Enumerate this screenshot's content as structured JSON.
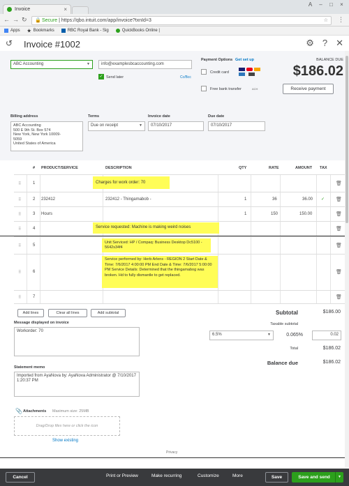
{
  "browser": {
    "tab_title": "Invoice",
    "secure_label": "Secure",
    "url": "https://qbo.intuit.com/app/invoice?txnId=3",
    "bookmarks": [
      "Apps",
      "Bookmarks",
      "RBC Royal Bank - Sig",
      "QuickBooks Online |"
    ]
  },
  "header": {
    "title": "Invoice #1002"
  },
  "customer": {
    "name": "ABC Accounting",
    "email": "info@examplesbcaccounting.com",
    "send_later": "Send later",
    "ccbcc": "Cc/Bcc"
  },
  "payment": {
    "label": "Payment Options",
    "setup_link": "Get set up",
    "credit_card": "Credit card",
    "bank_transfer": "Free bank transfer"
  },
  "balance": {
    "label": "BALANCE DUE",
    "amount": "$186.02",
    "receive_button": "Receive payment"
  },
  "billing": {
    "label": "Billing address",
    "lines": [
      "ABC Accounting",
      "500 E 9th St. Box 574",
      "New York, New York 10009-",
      "5059",
      "United States of America"
    ]
  },
  "terms": {
    "label": "Terms",
    "value": "Due on receipt"
  },
  "invoice_date": {
    "label": "Invoice date",
    "value": "07/10/2017"
  },
  "due_date": {
    "label": "Due date",
    "value": "07/10/2017"
  },
  "table": {
    "headers": {
      "num": "#",
      "product": "PRODUCT/SERVICE",
      "description": "DESCRIPTION",
      "qty": "QTY",
      "rate": "RATE",
      "amount": "AMOUNT",
      "tax": "TAX"
    },
    "rows": [
      {
        "num": "1",
        "product": "",
        "description": "Charges for work order: 70",
        "qty": "",
        "rate": "",
        "amount": "",
        "tax": ""
      },
      {
        "num": "2",
        "product": "232412",
        "description": "232412 - Thingamabob -",
        "qty": "1",
        "rate": "36",
        "amount": "36.00",
        "tax": "✓"
      },
      {
        "num": "3",
        "product": "Hours",
        "description": "",
        "qty": "1",
        "rate": "150",
        "amount": "150.00",
        "tax": ""
      },
      {
        "num": "4",
        "product": "",
        "description": "Service requested: Machine is making weird noises",
        "qty": "",
        "rate": "",
        "amount": "",
        "tax": ""
      },
      {
        "num": "5",
        "product": "",
        "description": "Unit Serviced: HP / Compaq: Business Desktop Dc5100 - 5642s34f4",
        "qty": "",
        "rate": "",
        "amount": "",
        "tax": ""
      },
      {
        "num": "6",
        "product": "",
        "description": "Service performed by: Herb Arlens - REGION 2 Start Date & Time: 7/6/2017 4:00:00 PM End Date & Time: 7/6/2017 5:00:00 PM Service Details: Determined that the thingamabog was broken. Hd to fully dismantle to get replaced.",
        "qty": "",
        "rate": "",
        "amount": "",
        "tax": ""
      },
      {
        "num": "7",
        "product": "",
        "description": "",
        "qty": "",
        "rate": "",
        "amount": "",
        "tax": ""
      }
    ]
  },
  "actions": {
    "add_lines": "Add lines",
    "clear_lines": "Clear all lines",
    "add_subtotal": "Add subtotal"
  },
  "message": {
    "label": "Message displayed on invoice",
    "value": "Workorder: 70"
  },
  "statement": {
    "label": "Statement memo",
    "value": "Imported from AyaNova by: AyaNova Administrator @ 7/10/2017 1:20:37 PM"
  },
  "attachments": {
    "label": "Attachments",
    "max": "Maximum size: 25MB",
    "drop": "Drag/Drop files here or click the icon",
    "show": "Show existing"
  },
  "totals": {
    "subtotal_label": "Subtotal",
    "subtotal": "$186.00",
    "taxable_label": "Taxable subtotal",
    "tax_rate": "6.5%",
    "tax_pct": "0.065%",
    "tax_value": "0.02",
    "total_label": "Total",
    "total": "$186.02",
    "balance_label": "Balance due",
    "balance": "$186.02"
  },
  "privacy": "Privacy",
  "footer": {
    "cancel": "Cancel",
    "print": "Print or Preview",
    "recurring": "Make recurring",
    "customize": "Customize",
    "more": "More",
    "save": "Save",
    "save_send": "Save and send"
  }
}
